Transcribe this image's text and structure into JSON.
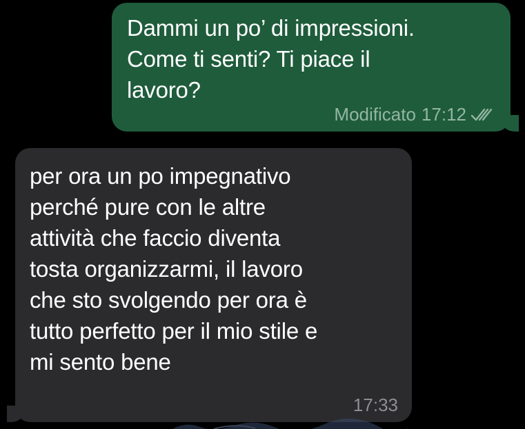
{
  "outgoing_message": {
    "text": "Dammi un po’ di impressioni.\nCome ti senti? Ti piace il\nlavoro?",
    "edited_label": "Modificato",
    "time": "17:12",
    "status_icon": "double-check-read-icon"
  },
  "incoming_message": {
    "text": "per ora un po impegnativo\nperché  pure con le altre\nattività che faccio diventa\ntosta organizzarmi, il lavoro\nche sto svolgendo per ora è\ntutto perfetto per il mio stile e\nmi sento bene",
    "time": "17:33"
  },
  "colors": {
    "background": "#000000",
    "outgoing_bubble": "#1f5c3c",
    "incoming_bubble": "#2b2b2e",
    "text": "#ffffff",
    "outgoing_meta": "#93b7a2",
    "incoming_meta": "#8e8e93"
  }
}
